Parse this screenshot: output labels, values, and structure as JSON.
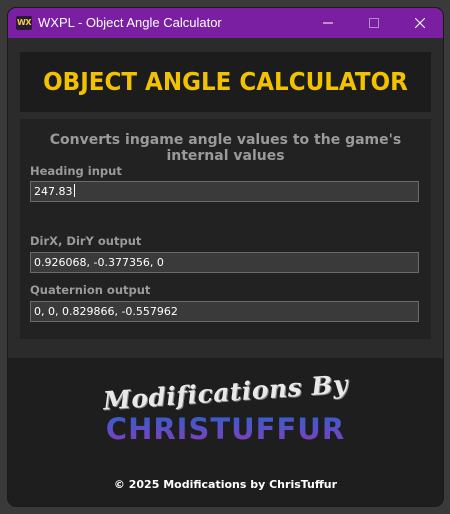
{
  "window": {
    "icon_text": "WX",
    "title": "WXPL - Object Angle Calculator"
  },
  "header": {
    "title": "OBJECT ANGLE CALCULATOR"
  },
  "main": {
    "subtitle": "Converts ingame angle values to the game's internal values",
    "heading_label": "Heading input",
    "heading_value": "247.83",
    "dir_label": "DirX, DirY output",
    "dir_value": "0.926068, -0.377356, 0",
    "quat_label": "Quaternion output",
    "quat_value": "0, 0, 0.829866, -0.557962"
  },
  "footer": {
    "logo_script": "Modifications By",
    "logo_name": "CHRISTUFFUR",
    "copyright": "© 2025 Modifications by ChrisTuffur"
  },
  "colors": {
    "titlebar": "#7a1fa2",
    "accent_title": "#f2c200"
  }
}
